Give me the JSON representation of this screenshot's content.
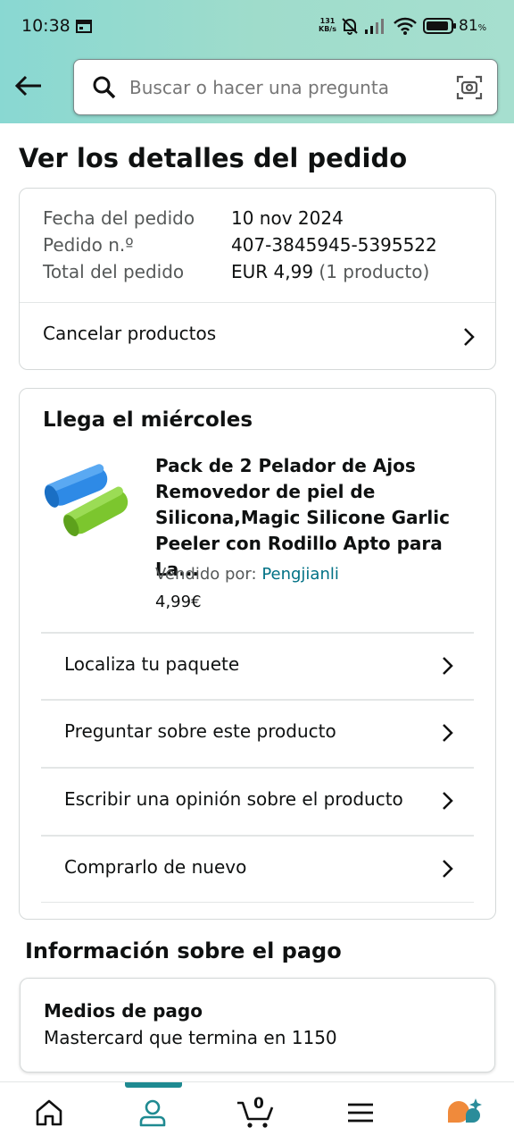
{
  "status_bar": {
    "time": "10:38",
    "net_speed_value": "131",
    "net_speed_unit": "KB/s",
    "battery_percent": "81",
    "battery_unit": "%"
  },
  "header": {
    "search_placeholder": "Buscar o hacer una pregunta"
  },
  "page_title": "Ver los detalles del pedido",
  "order_summary": {
    "rows": [
      {
        "label": "Fecha del pedido",
        "value": "10 nov 2024"
      },
      {
        "label": "Pedido n.º",
        "value": "407-3845945-5395522"
      },
      {
        "label": "Total del pedido",
        "value": "EUR 4,99",
        "note": "(1 producto)"
      }
    ],
    "cancel_label": "Cancelar productos"
  },
  "shipment": {
    "heading": "Llega el miércoles",
    "product": {
      "title": "Pack de 2 Pelador de Ajos Removedor de piel de Silicona,Magic Silicone Garlic Peeler con Rodillo Apto para La...",
      "seller_label": "Vendido por:",
      "seller_name": "Pengjianli",
      "price": "4,99€"
    },
    "actions": [
      {
        "label": "Localiza tu paquete"
      },
      {
        "label": "Preguntar sobre este producto"
      },
      {
        "label": "Escribir una opinión sobre el producto"
      },
      {
        "label": "Comprarlo de nuevo"
      }
    ]
  },
  "payment": {
    "heading": "Información sobre el pago",
    "method_label": "Medios de pago",
    "method_value": "Mastercard  que termina en 1150"
  },
  "bottom_nav": {
    "cart_count": "0",
    "items": [
      "home-icon",
      "account-icon",
      "cart-icon",
      "menu-icon",
      "rufus-icon"
    ]
  },
  "colors": {
    "header_gradient_start": "#89d8d2",
    "header_gradient_end": "#a6dfcf",
    "link": "#007185",
    "nav_indicator": "#1f8a91",
    "rufus_orange": "#f08a3b"
  }
}
